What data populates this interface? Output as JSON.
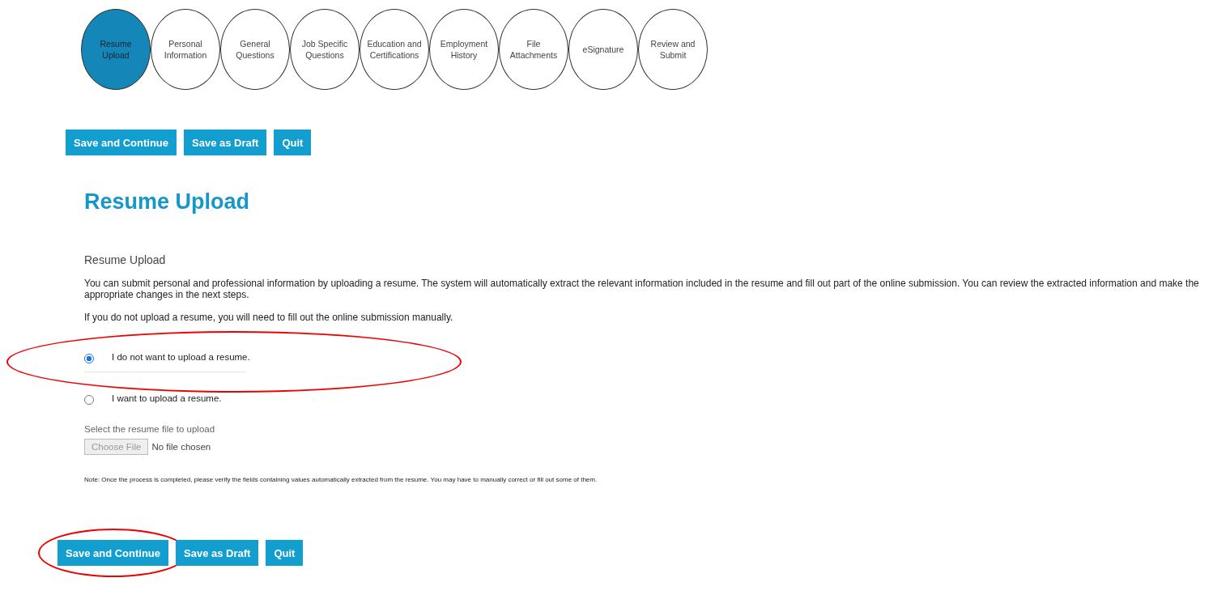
{
  "steps": [
    {
      "label": "Resume Upload",
      "selected": true
    },
    {
      "label": "Personal Information",
      "selected": false
    },
    {
      "label": "General Questions",
      "selected": false
    },
    {
      "label": "Job Specific Questions",
      "selected": false
    },
    {
      "label": "Education and Certifications",
      "selected": false
    },
    {
      "label": "Employment History",
      "selected": false
    },
    {
      "label": "File Attachments",
      "selected": false
    },
    {
      "label": "eSignature",
      "selected": false
    },
    {
      "label": "Review and Submit",
      "selected": false
    }
  ],
  "top_buttons": [
    {
      "label": "Save and Continue",
      "circled": false
    },
    {
      "label": "Save as Draft",
      "circled": false
    },
    {
      "label": "Quit",
      "circled": false
    }
  ],
  "heading": "Resume Upload",
  "section_title": "Resume Upload",
  "paragraphs": [
    "You can submit personal and professional information by uploading a resume. The system will automatically extract the relevant information included in the resume and fill out part of the online submission. You can review the extracted information and make the appropriate changes in the next steps.",
    "If you do not upload a resume, you will need to fill out the online submission manually."
  ],
  "options": [
    {
      "label": "I do not want to upload a resume.",
      "selected": true,
      "circled": true
    },
    {
      "label": "I want to upload a resume.",
      "selected": false,
      "circled": false
    }
  ],
  "file_field": {
    "label": "Select the resume file to upload",
    "button": "Choose File",
    "status": "No file chosen",
    "disabled": true
  },
  "note": "Note: Once the process is completed, please verify the fields containing values automatically extracted from the resume. You may have to manually correct or fill out some of them.",
  "bottom_buttons": [
    {
      "label": "Save and Continue",
      "circled": true
    },
    {
      "label": "Save as Draft",
      "circled": false
    },
    {
      "label": "Quit",
      "circled": false
    }
  ]
}
